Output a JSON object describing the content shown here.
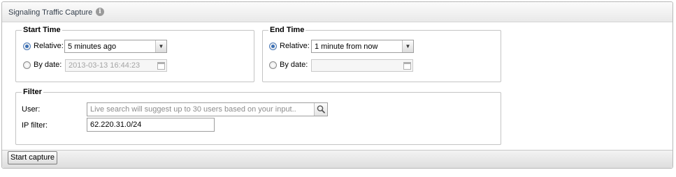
{
  "panel": {
    "title": "Signaling Traffic Capture",
    "info_icon": "i"
  },
  "start_time": {
    "legend": "Start Time",
    "relative_label": "Relative:",
    "relative_selected": true,
    "relative_value": "5 minutes ago",
    "by_date_label": "By date:",
    "by_date_value": "2013-03-13 16:44:23"
  },
  "end_time": {
    "legend": "End Time",
    "relative_label": "Relative:",
    "relative_selected": true,
    "relative_value": "1 minute from now",
    "by_date_label": "By date:",
    "by_date_value": ""
  },
  "filter": {
    "legend": "Filter",
    "user_label": "User:",
    "user_placeholder": "Live search will suggest up to 30 users based on your input..",
    "user_value": "",
    "ip_label": "IP filter:",
    "ip_value": "62.220.31.0/24"
  },
  "footer": {
    "start_capture_label": "Start capture"
  },
  "icons": {
    "info": "info-icon",
    "dropdown": "chevron-down-icon",
    "calendar": "calendar-icon",
    "search": "search-icon"
  }
}
